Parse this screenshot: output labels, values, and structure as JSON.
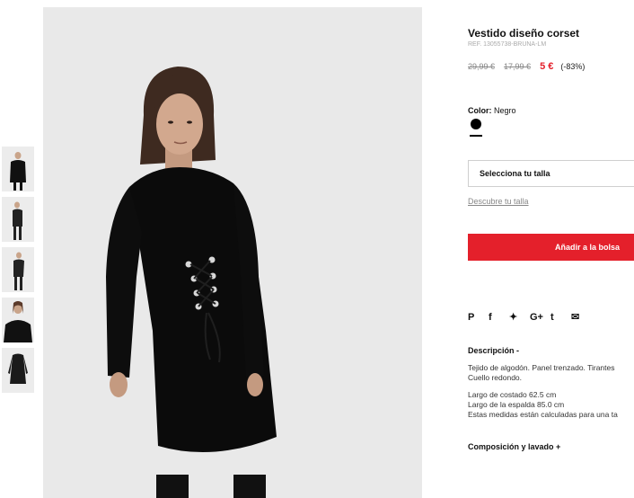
{
  "product": {
    "title": "Vestido diseño corset",
    "ref": "REF. 13055738-BRUNA-LM",
    "price_original": "29,99 €",
    "price_previous": "17,99 €",
    "price_current": "5 €",
    "discount": "(-83%)"
  },
  "color": {
    "label": "Color:",
    "value": "Negro",
    "swatch_hex": "#000000"
  },
  "size": {
    "select_label": "Selecciona tu talla",
    "guide_link": "Descubre tu talla"
  },
  "cta": {
    "add_to_bag": "Añadir a la bolsa"
  },
  "share": {
    "icons": [
      "pinterest-icon",
      "facebook-icon",
      "twitter-icon",
      "google-plus-icon",
      "tumblr-icon",
      "email-icon"
    ],
    "glyphs": [
      "P",
      "f",
      "✦",
      "G+",
      "t",
      "✉"
    ]
  },
  "description": {
    "heading": "Descripción  -",
    "line1": "Tejido de algodón. Panel trenzado. Tirantes",
    "line2": "Cuello redondo.",
    "line3": "Largo de costado 62.5 cm",
    "line4": "Largo de la espalda 85.0 cm",
    "line5": "Estas medidas están calculadas para una ta"
  },
  "composition": {
    "heading": "Composición y lavado  +"
  },
  "colors": {
    "accent": "#e4202b",
    "background": "#ffffff",
    "image_bg": "#e9e9e9"
  }
}
